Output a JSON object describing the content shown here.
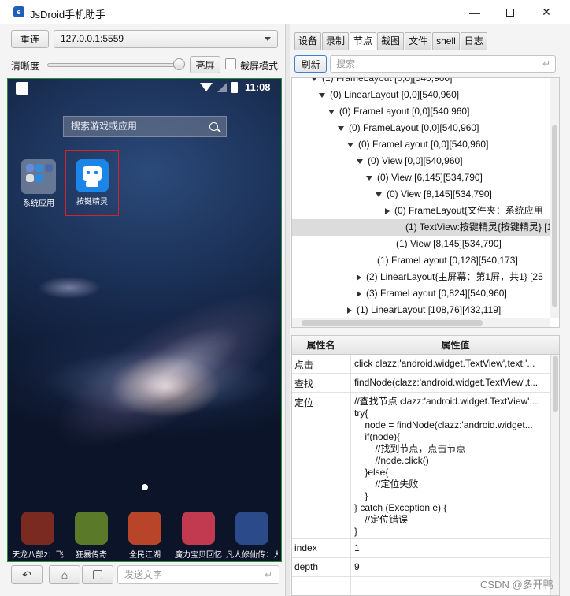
{
  "window": {
    "title": "JsDroid手机助手",
    "minimize": "—",
    "close": "✕"
  },
  "left": {
    "reconnect_label": "重连",
    "device": "127.0.0.1:5559",
    "clarity_label": "清晰度",
    "clarity_level": 0.95,
    "brighten_label": "亮屏",
    "screenshot_mode_label": "截屏模式",
    "screenshot_mode_checked": false,
    "send_text_placeholder": "发送文字",
    "enter_glyph": "↵"
  },
  "phone": {
    "clock": "11:08",
    "search_placeholder": "搜索游戏或应用",
    "apps": [
      {
        "label": "系统应用"
      },
      {
        "label": "按键精灵"
      }
    ],
    "dock": [
      {
        "label": "天龙八部2：飞",
        "color": "#7a2a20"
      },
      {
        "label": "狂暴传奇",
        "color": "#5a7a2a"
      },
      {
        "label": "全民江湖",
        "color": "#b8442a"
      },
      {
        "label": "魔力宝贝回忆",
        "color": "#c23a50"
      },
      {
        "label": "凡人修仙传：人",
        "color": "#2a4a8a"
      }
    ]
  },
  "right": {
    "tabs": [
      {
        "label": "设备"
      },
      {
        "label": "录制"
      },
      {
        "label": "节点",
        "active": true
      },
      {
        "label": "截图"
      },
      {
        "label": "文件"
      },
      {
        "label": "shell"
      },
      {
        "label": "日志"
      }
    ],
    "refresh_label": "刷新",
    "search_placeholder": "搜索",
    "tree": [
      {
        "text": "(1) FrameLayout [0,0][540,960]",
        "arrow": "down"
      },
      {
        "text": "(0) LinearLayout [0,0][540,960]",
        "arrow": "down"
      },
      {
        "text": "(0) FrameLayout [0,0][540,960]",
        "arrow": "down"
      },
      {
        "text": "(0) FrameLayout [0,0][540,960]",
        "arrow": "down"
      },
      {
        "text": "(0) FrameLayout [0,0][540,960]",
        "arrow": "down"
      },
      {
        "text": "(0) View [0,0][540,960]",
        "arrow": "down"
      },
      {
        "text": "(0) View [6,145][534,790]",
        "arrow": "down"
      },
      {
        "text": "(0) View [8,145][534,790]",
        "arrow": "down"
      },
      {
        "text": "(0) FrameLayout{文件夹：系统应用",
        "arrow": "right"
      },
      {
        "text": "(1) TextView:按键精灵{按键精灵} [1",
        "arrow": "none",
        "selected": true
      },
      {
        "text": "(1) View [8,145][534,790]",
        "arrow": "none"
      },
      {
        "text": "(1) FrameLayout [0,128][540,173]",
        "arrow": "none"
      },
      {
        "text": "(2) LinearLayout{主屏幕：第1屏，共1} [25",
        "arrow": "right"
      },
      {
        "text": "(3) FrameLayout [0,824][540,960]",
        "arrow": "right"
      },
      {
        "text": "(1) LinearLayout [108,76][432,119]",
        "arrow": "right"
      }
    ],
    "props_headers": {
      "name": "属性名",
      "value": "属性值"
    },
    "props": [
      {
        "name": "点击",
        "value": "click clazz:'android.widget.TextView',text:'..."
      },
      {
        "name": "查找",
        "value": "findNode(clazz:'android.widget.TextView',t..."
      },
      {
        "name": "定位",
        "value": "//查找节点 clazz:'android.widget.TextView',...\ntry{\n    node = findNode(clazz:'android.widget...\n    if(node){\n        //找到节点，点击节点\n        //node.click()\n    }else{\n        //定位失败\n    }\n} catch (Exception e) {\n    //定位错误\n}"
      },
      {
        "name": "index",
        "value": "1"
      },
      {
        "name": "depth",
        "value": "9"
      }
    ]
  },
  "watermark": "CSDN @多开鸭"
}
